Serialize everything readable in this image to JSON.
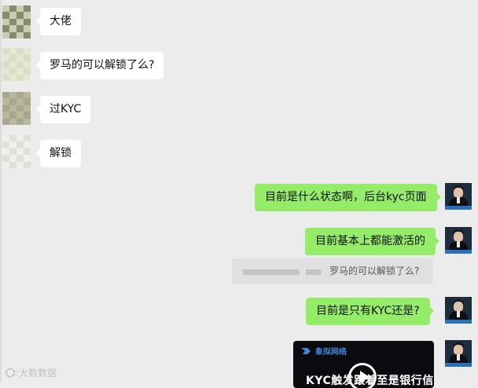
{
  "chat": {
    "incoming": [
      {
        "text": "大佬"
      },
      {
        "text": "罗马的可以解锁了么?"
      },
      {
        "text": "过KYC"
      },
      {
        "text": "解锁"
      }
    ],
    "outgoing": [
      {
        "text": "目前是什么状态啊，后台kyc页面"
      },
      {
        "text": "目前基本上都能激活的"
      },
      {
        "text": "目前是只有KYC还是?"
      }
    ],
    "quote": {
      "text": "罗马的可以解锁了么?"
    },
    "video": {
      "brand": "象拟网络",
      "caption": "KYC触发跟着至是银行信通"
    }
  },
  "watermark": {
    "text": "大数数据"
  },
  "colors": {
    "background": "#ececec",
    "incoming_bubble": "#ffffff",
    "outgoing_bubble": "#95ec69",
    "quote_bg": "#e0e0e0"
  },
  "icons": [
    "blurred-avatar",
    "user-avatar",
    "play-icon",
    "brand-logo-icon",
    "watermark-icon"
  ]
}
